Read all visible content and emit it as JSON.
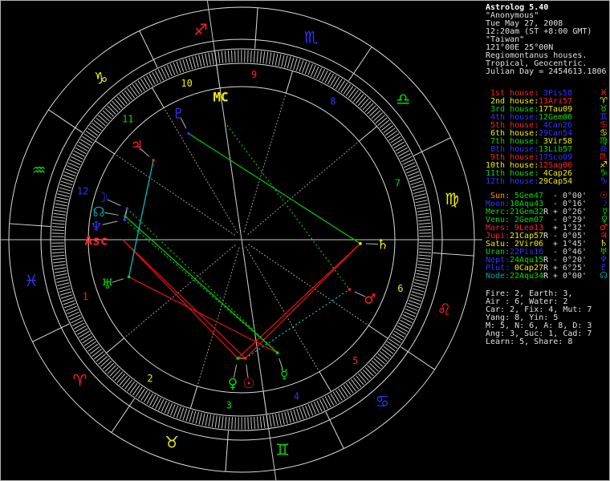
{
  "app": {
    "name": "Astrolog 5.40"
  },
  "info_lines": [
    "\"Anonymous\"",
    "Tue May 27, 2008",
    "12:20am (ST +8:00 GMT)",
    "\"Taiwan\"",
    "121°00E 25°00N",
    "Regiomontanus houses.",
    "Tropical, Geocentric.",
    "Julian Day = 2454613.1806"
  ],
  "colors": {
    "red": "#ff2020",
    "yellow": "#eeee00",
    "green": "#00dd00",
    "blue": "#3333ff",
    "teal": "#00a0a0",
    "orange": "#ff9900",
    "white": "#e8e8e8",
    "grey": "#c8c8c8",
    "cyan": "#00cccc",
    "dim_grey": "#999999"
  },
  "houses": [
    {
      "label": " 1st house:",
      "label_color": "#ff2020",
      "value": "3Pis58",
      "value_color": "#3333ff",
      "glyph": "♓",
      "glyph_color": "#ff2020",
      "lambda": 333.967
    },
    {
      "label": " 2nd house:",
      "label_color": "#eeee00",
      "value": "13Ari57",
      "value_color": "#ff2020",
      "glyph": "♈",
      "glyph_color": "#eeee00",
      "lambda": 13.95
    },
    {
      "label": " 3rd house:",
      "label_color": "#00dd00",
      "value": "17Tau09",
      "value_color": "#eeee00",
      "glyph": "♉",
      "glyph_color": "#00dd00",
      "lambda": 47.15
    },
    {
      "label": " 4th house:",
      "label_color": "#3333ff",
      "value": "12Gem06",
      "value_color": "#00dd00",
      "glyph": "♊",
      "glyph_color": "#3333ff",
      "lambda": 72.1
    },
    {
      "label": " 5th house:",
      "label_color": "#ff2020",
      "value": "4Can26",
      "value_color": "#3333ff",
      "glyph": "♋",
      "glyph_color": "#ff2020",
      "lambda": 94.433
    },
    {
      "label": " 6th house:",
      "label_color": "#eeee00",
      "value": "29Can54",
      "value_color": "#3333ff",
      "glyph": "♋",
      "glyph_color": "#eeee00",
      "lambda": 119.9
    },
    {
      "label": " 7th house:",
      "label_color": "#00dd00",
      "value": "3Vir58",
      "value_color": "#eeee00",
      "glyph": "♍",
      "glyph_color": "#00dd00",
      "lambda": 153.967
    },
    {
      "label": " 8th house:",
      "label_color": "#3333ff",
      "value": "13Lib57",
      "value_color": "#00dd00",
      "glyph": "♎",
      "glyph_color": "#3333ff",
      "lambda": 193.95
    },
    {
      "label": " 9th house:",
      "label_color": "#ff2020",
      "value": "17Sco09",
      "value_color": "#3333ff",
      "glyph": "♏",
      "glyph_color": "#ff2020",
      "lambda": 227.15
    },
    {
      "label": "10th house:",
      "label_color": "#eeee00",
      "value": "12Sag06",
      "value_color": "#ff2020",
      "glyph": "♐",
      "glyph_color": "#eeee00",
      "lambda": 252.1
    },
    {
      "label": "11th house:",
      "label_color": "#00dd00",
      "value": "4Cap26",
      "value_color": "#eeee00",
      "glyph": "♑",
      "glyph_color": "#00dd00",
      "lambda": 274.433
    },
    {
      "label": "12th house:",
      "label_color": "#3333ff",
      "value": "29Cap54",
      "value_color": "#eeee00",
      "glyph": "♑",
      "glyph_color": "#3333ff",
      "lambda": 299.9
    }
  ],
  "planets": [
    {
      "name": "Sun",
      "label": " Sun:",
      "label_color": "#ff9900",
      "value": "5Gem47",
      "value_color": "#00dd00",
      "retro": " ",
      "velocity": "- 0°00'",
      "glyph": "☉",
      "glyph_color": "#ff2020",
      "lambda": 65.783
    },
    {
      "name": "Moon",
      "label": "Moon:",
      "label_color": "#3333ff",
      "value": "18Aqu43",
      "value_color": "#00dd00",
      "retro": " ",
      "velocity": "- 0°16'",
      "glyph": "☽",
      "glyph_color": "#3333ff",
      "lambda": 318.717
    },
    {
      "name": "Merc",
      "label": "Merc:",
      "label_color": "#00dd00",
      "value": "21Gem32",
      "value_color": "#00dd00",
      "retro": "R",
      "velocity": "+ 0°26'",
      "glyph": "☿",
      "glyph_color": "#00dd00",
      "lambda": 81.533
    },
    {
      "name": "Venu",
      "label": "Venu:",
      "label_color": "#00dd00",
      "value": "2Gem07",
      "value_color": "#00dd00",
      "retro": " ",
      "velocity": "- 0°29'",
      "glyph": "♀",
      "glyph_color": "#00dd00",
      "lambda": 62.117
    },
    {
      "name": "Mars",
      "label": "Mars:",
      "label_color": "#ff2020",
      "value": "9Leo13",
      "value_color": "#ff2020",
      "retro": " ",
      "velocity": "+ 1°32'",
      "glyph": "♂",
      "glyph_color": "#ff2020",
      "lambda": 129.217
    },
    {
      "name": "Jupi",
      "label": "Jupi:",
      "label_color": "#ff2020",
      "value": "21Cap57",
      "value_color": "#eeee00",
      "retro": "R",
      "velocity": "- 0°05'",
      "glyph": "♃",
      "glyph_color": "#ff2020",
      "lambda": 291.95
    },
    {
      "name": "Satu",
      "label": "Satu:",
      "label_color": "#eeee00",
      "value": "2Vir06",
      "value_color": "#eeee00",
      "retro": " ",
      "velocity": "+ 1°45'",
      "glyph": "♄",
      "glyph_color": "#eeee00",
      "lambda": 152.1
    },
    {
      "name": "Uran",
      "label": "Uran:",
      "label_color": "#00dd00",
      "value": "22Pis16",
      "value_color": "#3333ff",
      "retro": " ",
      "velocity": "- 0°46'",
      "glyph": "♅",
      "glyph_color": "#00dd00",
      "lambda": 352.267
    },
    {
      "name": "Nept",
      "label": "Nept:",
      "label_color": "#3333ff",
      "value": "24Aqu15",
      "value_color": "#00dd00",
      "retro": "R",
      "velocity": "- 0°20'",
      "glyph": "♆",
      "glyph_color": "#3333ff",
      "lambda": 324.25
    },
    {
      "name": "Plut",
      "label": "Plut:",
      "label_color": "#3333ff",
      "value": "0Cap27",
      "value_color": "#eeee00",
      "retro": "R",
      "velocity": "+ 6°25'",
      "glyph": "♇",
      "glyph_color": "#3333ff",
      "lambda": 270.45
    },
    {
      "name": "Node",
      "label": "Node:",
      "label_color": "#00a0a0",
      "value": "22Aqu34",
      "value_color": "#00dd00",
      "retro": "R",
      "velocity": "+ 0°00'",
      "glyph": "☊",
      "glyph_color": "#00a0a0",
      "lambda": 322.567
    }
  ],
  "stats_lines": [
    "Fire: 2, Earth: 3,",
    "Air : 6, Water: 2",
    "Car: 2, Fix: 4, Mut: 7",
    "Yang: 8, Yin: 5",
    "M: 5, N: 6, A: 8, D: 3",
    "Ang: 3, Suc: 1, Cad: 7",
    "Learn: 5, Share: 8"
  ],
  "wheel": {
    "signs": [
      {
        "name": "aries",
        "glyph": "♈",
        "color": "#ff2020",
        "lambda_mid": 15
      },
      {
        "name": "taurus",
        "glyph": "♉",
        "color": "#eeee00",
        "lambda_mid": 45
      },
      {
        "name": "gemini",
        "glyph": "♊",
        "color": "#00dd00",
        "lambda_mid": 75
      },
      {
        "name": "cancer",
        "glyph": "♋",
        "color": "#3333ff",
        "lambda_mid": 105
      },
      {
        "name": "leo",
        "glyph": "♌",
        "color": "#ff2020",
        "lambda_mid": 135
      },
      {
        "name": "virgo",
        "glyph": "♍",
        "color": "#eeee00",
        "lambda_mid": 165
      },
      {
        "name": "libra",
        "glyph": "♎",
        "color": "#00dd00",
        "lambda_mid": 195
      },
      {
        "name": "scorpio",
        "glyph": "♏",
        "color": "#3333ff",
        "lambda_mid": 225
      },
      {
        "name": "sagittarius",
        "glyph": "♐",
        "color": "#ff2020",
        "lambda_mid": 255
      },
      {
        "name": "capricorn",
        "glyph": "♑",
        "color": "#eeee00",
        "lambda_mid": 285
      },
      {
        "name": "aquarius",
        "glyph": "♒",
        "color": "#00dd00",
        "lambda_mid": 315
      },
      {
        "name": "pisces",
        "glyph": "♓",
        "color": "#3333ff",
        "lambda_mid": 345
      }
    ],
    "asc_label": {
      "text": "Asc",
      "color": "#ff2020"
    },
    "mc_label": {
      "text": "MC",
      "color": "#eeee00"
    },
    "angles": {
      "Asc": 333.967,
      "MC": 252.1
    }
  },
  "aspect_colors": {
    "conjunction": "#cccc00",
    "square": "#ee1111",
    "trine": "#00cc00",
    "sextile": "#00cccc"
  },
  "aspects": [
    {
      "a": "Sun",
      "b": "Venu",
      "type": "conjunction",
      "style": "solid"
    },
    {
      "a": "Moon",
      "b": "Nept",
      "type": "conjunction",
      "style": "solid"
    },
    {
      "a": "Moon",
      "b": "Node",
      "type": "conjunction",
      "style": "solid"
    },
    {
      "a": "Nept",
      "b": "Node",
      "type": "conjunction",
      "style": "solid"
    },
    {
      "a": "Sun",
      "b": "Satu",
      "type": "square",
      "style": "solid"
    },
    {
      "a": "Venu",
      "b": "Satu",
      "type": "square",
      "style": "solid"
    },
    {
      "a": "Merc",
      "b": "Uran",
      "type": "square",
      "style": "solid"
    },
    {
      "a": "Asc",
      "b": "Sun",
      "type": "square",
      "style": "solid"
    },
    {
      "a": "Asc",
      "b": "Venu",
      "type": "square",
      "style": "solid"
    },
    {
      "a": "Satu",
      "b": "Plut",
      "type": "trine",
      "style": "solid"
    },
    {
      "a": "Node",
      "b": "Merc",
      "type": "trine",
      "style": "solid"
    },
    {
      "a": "Moon",
      "b": "Merc",
      "type": "trine",
      "style": "dotted"
    },
    {
      "a": "Nept",
      "b": "Merc",
      "type": "trine",
      "style": "dotted"
    },
    {
      "a": "MC",
      "b": "Mars",
      "type": "trine",
      "style": "dotted"
    },
    {
      "a": "Jupi",
      "b": "Uran",
      "type": "sextile",
      "style": "solid"
    },
    {
      "a": "Sun",
      "b": "Mars",
      "type": "sextile",
      "style": "dotted"
    }
  ]
}
